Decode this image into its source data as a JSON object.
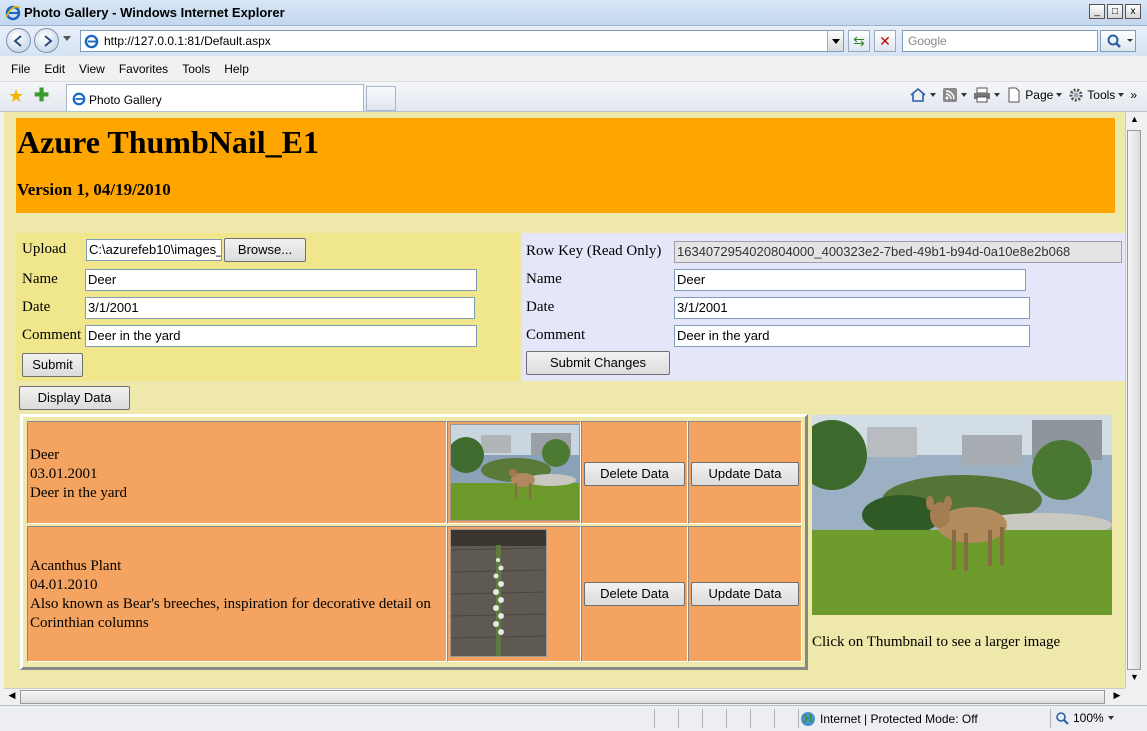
{
  "window": {
    "title": "Photo Gallery - Windows Internet Explorer",
    "controls": [
      "_",
      "□",
      "x"
    ]
  },
  "address_bar": {
    "url": "http://127.0.0.1:81/Default.aspx",
    "search_placeholder": "Google"
  },
  "menu": {
    "items": [
      "File",
      "Edit",
      "View",
      "Favorites",
      "Tools",
      "Help"
    ]
  },
  "tabs": {
    "active_tab": "Photo Gallery"
  },
  "command_bar": {
    "page_label": "Page",
    "tools_label": "Tools"
  },
  "header": {
    "title": "Azure ThumbNail_E1",
    "version": "Version 1, 04/19/2010"
  },
  "upload_form": {
    "upload_label": "Upload",
    "upload_value": "C:\\azurefeb10\\images_",
    "browse_label": "Browse...",
    "name_label": "Name",
    "name_value": "Deer",
    "date_label": "Date",
    "date_value": "3/1/2001",
    "comment_label": "Comment",
    "comment_value": "Deer in the yard",
    "submit_label": "Submit"
  },
  "edit_form": {
    "rowkey_label": "Row Key (Read Only)",
    "rowkey_value": "1634072954020804000_400323e2-7bed-49b1-b94d-0a10e8e2b068",
    "name_label": "Name",
    "name_value": "Deer",
    "date_label": "Date",
    "date_value": "3/1/2001",
    "comment_label": "Comment",
    "comment_value": "Deer in the yard",
    "submit_label": "Submit Changes"
  },
  "display_button": "Display Data",
  "rows": [
    {
      "name": "Deer",
      "date": "03.01.2001",
      "comment": "Deer in the yard",
      "delete_label": "Delete Data",
      "update_label": "Update Data"
    },
    {
      "name": "Acanthus Plant",
      "date": "04.01.2010",
      "comment": "Also known as Bear's breeches, inspiration for decorative detail on Corinthian columns",
      "delete_label": "Delete Data",
      "update_label": "Update Data"
    }
  ],
  "preview_caption": "Click on Thumbnail to see a larger image",
  "status_bar": {
    "zone": "Internet | Protected Mode: Off",
    "zoom": "100%"
  },
  "colors": {
    "header_bg": "#ffa500",
    "page_bg": "#eee8aa",
    "upload_panel_bg": "#f0e68c",
    "edit_panel_bg": "#e6e6fa",
    "table_cell_bg": "#f4a460"
  }
}
